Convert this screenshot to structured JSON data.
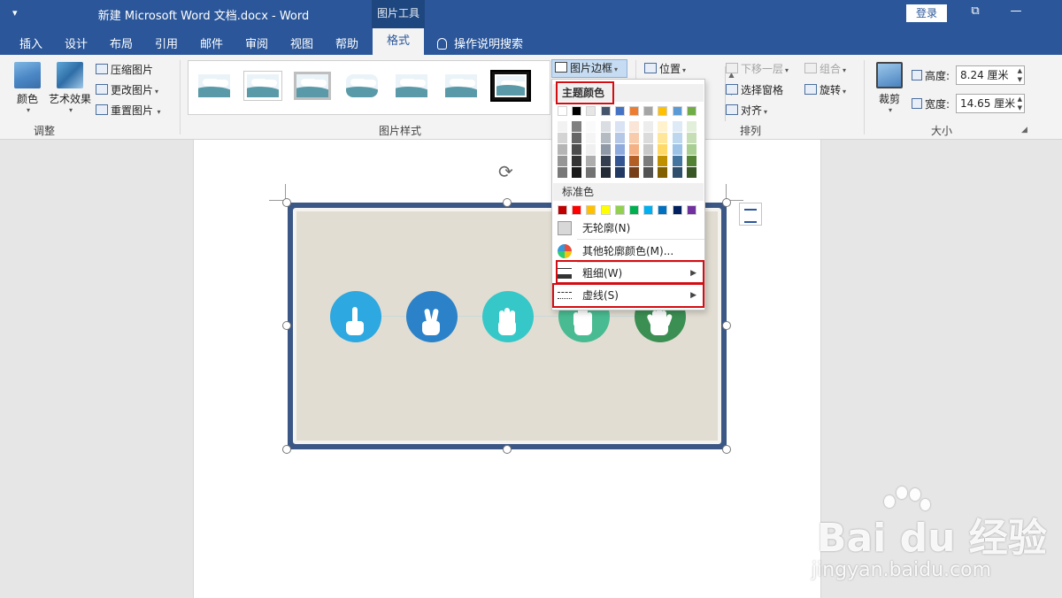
{
  "titlebar": {
    "quick_access": "▾",
    "title": "新建 Microsoft Word 文档.docx  -  Word",
    "context_tab": "图片工具",
    "login": "登录",
    "restore": "⧉",
    "minimize": "—"
  },
  "tabs": {
    "insert": "插入",
    "design": "设计",
    "layout": "布局",
    "references": "引用",
    "mailings": "邮件",
    "review": "审阅",
    "view": "视图",
    "help": "帮助",
    "format": "格式",
    "tell_me": "操作说明搜索"
  },
  "ribbon": {
    "adjust": {
      "color": "颜色",
      "artistic": "艺术效果",
      "compress": "压缩图片",
      "change": "更改图片",
      "reset": "重置图片",
      "label": "调整"
    },
    "styles": {
      "label": "图片样式",
      "border": "图片边框"
    },
    "arrange": {
      "position": "位置",
      "send_backward": "下移一层",
      "selection_pane": "选择窗格",
      "align": "对齐",
      "group": "组合",
      "rotate": "旋转",
      "label": "排列"
    },
    "size": {
      "crop": "裁剪",
      "height_label": "高度:",
      "height_value": "8.24 厘米",
      "width_label": "宽度:",
      "width_value": "14.65 厘米",
      "label": "大小"
    }
  },
  "dropdown": {
    "theme_colors": "主题颜色",
    "standard_colors": "标准色",
    "no_outline": "无轮廓(N)",
    "more_colors": "其他轮廓颜色(M)...",
    "weight": "粗细(W)",
    "dashes": "虚线(S)",
    "theme_row": [
      "#ffffff",
      "#000000",
      "#e7e6e6",
      "#44546a",
      "#4472c4",
      "#ed7d31",
      "#a5a5a5",
      "#ffc000",
      "#5b9bd5",
      "#70ad47"
    ],
    "standard_row": [
      "#c00000",
      "#ff0000",
      "#ffc000",
      "#ffff00",
      "#92d050",
      "#00b050",
      "#00b0f0",
      "#0070c0",
      "#002060",
      "#7030a0"
    ]
  },
  "picture": {
    "circle_colors": [
      "#2da8e0",
      "#2b82c8",
      "#36c8c8",
      "#49bb93",
      "#3b8f53"
    ],
    "frame_color": "#3a5785"
  },
  "watermark": {
    "main": "Bai du 经验",
    "sub": "jingyan.baidu.com"
  }
}
